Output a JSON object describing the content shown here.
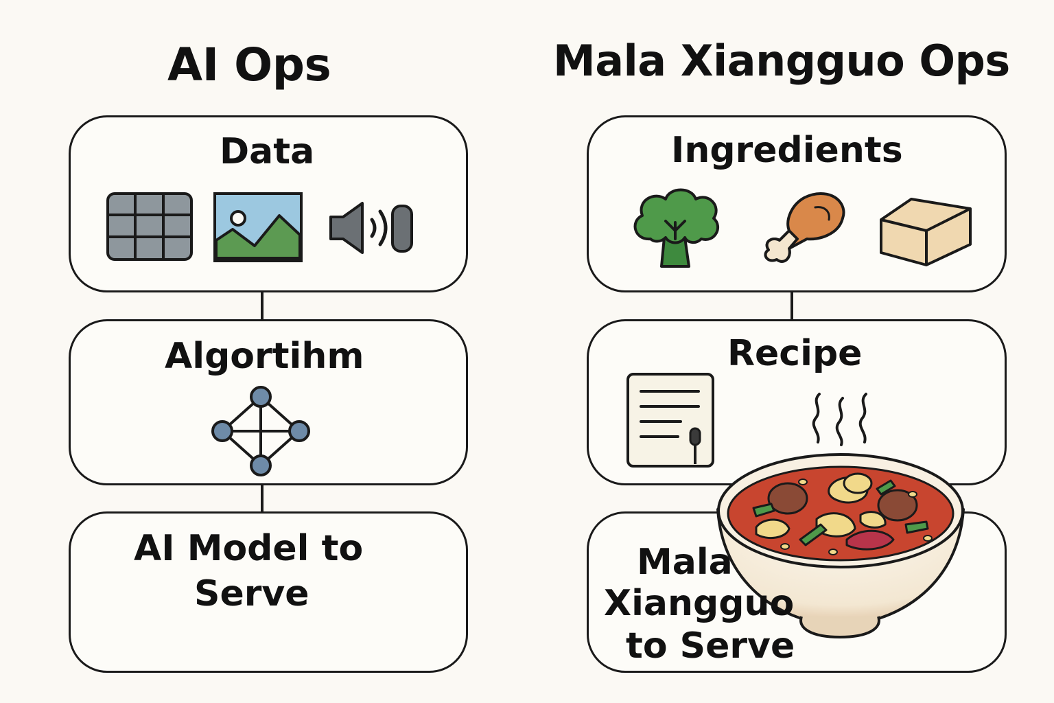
{
  "left": {
    "title": "AI Ops",
    "data_label": "Data",
    "algorithm_label": "Algortihm",
    "model_label_line1": "AI Model to",
    "model_label_line2": "Serve",
    "icons": [
      "table-icon",
      "image-icon",
      "audio-icon",
      "network-graph-icon"
    ]
  },
  "right": {
    "title": "Mala Xiangguo Ops",
    "ingredients_label": "Ingredients",
    "recipe_label": "Recipe",
    "serve_label_line1": "Mala",
    "serve_label_line2": "Xiangguo",
    "serve_label_line3": "to Serve",
    "icons": [
      "broccoli-icon",
      "chicken-leg-icon",
      "tofu-icon",
      "recipe-document-icon",
      "steam-icon",
      "mala-bowl-icon"
    ]
  },
  "colors": {
    "background": "#fbf9f4",
    "outline": "#1a1a1a",
    "node_blue": "#6e8ba8",
    "green": "#4f9a4a",
    "chicken": "#d9884a",
    "tofu": "#f0d8b0",
    "broth": "#c8452f"
  }
}
